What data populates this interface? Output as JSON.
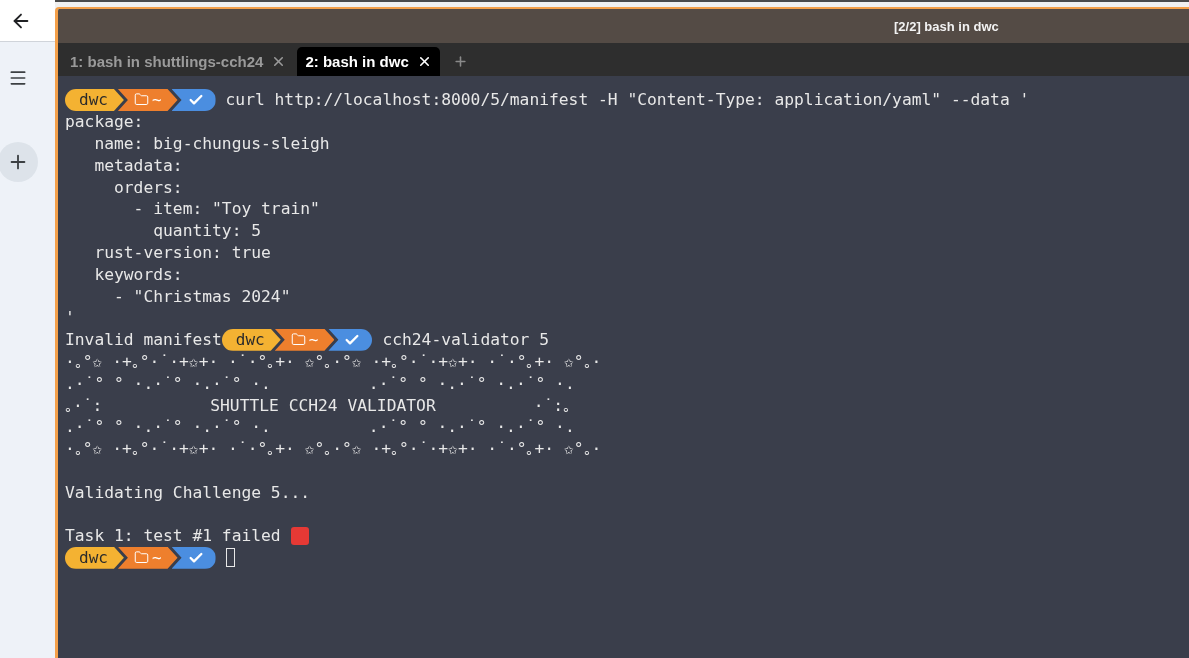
{
  "window": {
    "title": "[2/2] bash in dwc"
  },
  "tabs": [
    {
      "label": "1: bash in shuttlings-cch24",
      "selected": false
    },
    {
      "label": "2: bash in dwc",
      "selected": true
    }
  ],
  "lines": [
    {
      "kind": "command",
      "prompt": [
        {
          "kind": "text",
          "text": "dwc",
          "color": "#f4b232"
        },
        {
          "kind": "folder",
          "text": "~",
          "color": "#ee7f2d"
        },
        {
          "kind": "check",
          "color": "#4b8ee0"
        }
      ],
      "text": "curl http://localhost:8000/5/manifest -H \"Content-Type: application/yaml\" --data '"
    },
    {
      "kind": "output",
      "text": "package:"
    },
    {
      "kind": "output",
      "text": "   name: big-chungus-sleigh"
    },
    {
      "kind": "output",
      "text": "   metadata:"
    },
    {
      "kind": "output",
      "text": "     orders:"
    },
    {
      "kind": "output",
      "text": "       - item: \"Toy train\""
    },
    {
      "kind": "output",
      "text": "         quantity: 5"
    },
    {
      "kind": "output",
      "text": "   rust-version: true"
    },
    {
      "kind": "output",
      "text": "   keywords:"
    },
    {
      "kind": "output",
      "text": "     - \"Christmas 2024\""
    },
    {
      "kind": "output",
      "text": "'"
    },
    {
      "kind": "command",
      "before": "Invalid manifest",
      "prompt": [
        {
          "kind": "text",
          "text": "dwc",
          "color": "#f4b232"
        },
        {
          "kind": "folder",
          "text": "~",
          "color": "#ee7f2d"
        },
        {
          "kind": "check",
          "color": "#4b8ee0"
        }
      ],
      "text": "cch24-validator 5"
    },
    {
      "kind": "output",
      "text": "·｡°✩ ·+｡°·˙·+✩+· ·˙·°｡+· ✩°｡·°✩ ·+｡°·˙·+✩+· ·˙·°｡+· ✩°｡·"
    },
    {
      "kind": "output",
      "text": ".·˙° ° ·.·˙° ·.·˙° ·.          .·˙° ° ·.·˙° ·.·˙° ·."
    },
    {
      "kind": "output",
      "text": "｡·˙:           SHUTTLE CCH24 VALIDATOR          ·˙:｡"
    },
    {
      "kind": "output",
      "text": ".·˙° ° ·.·˙° ·.·˙° ·.          .·˙° ° ·.·˙° ·.·˙° ·."
    },
    {
      "kind": "output",
      "text": "·｡°✩ ·+｡°·˙·+✩+· ·˙·°｡+· ✩°｡·°✩ ·+｡°·˙·+✩+· ·˙·°｡+· ✩°｡·"
    },
    {
      "kind": "blank"
    },
    {
      "kind": "output",
      "text": "Validating Challenge 5..."
    },
    {
      "kind": "blank"
    },
    {
      "kind": "status",
      "text": "Task 1: test #1 failed",
      "failed": true
    },
    {
      "kind": "command",
      "prompt": [
        {
          "kind": "text",
          "text": "dwc",
          "color": "#f4b232"
        },
        {
          "kind": "folder",
          "text": "~",
          "color": "#ee7f2d"
        },
        {
          "kind": "check",
          "color": "#4b8ee0"
        }
      ],
      "cursor": true
    }
  ]
}
